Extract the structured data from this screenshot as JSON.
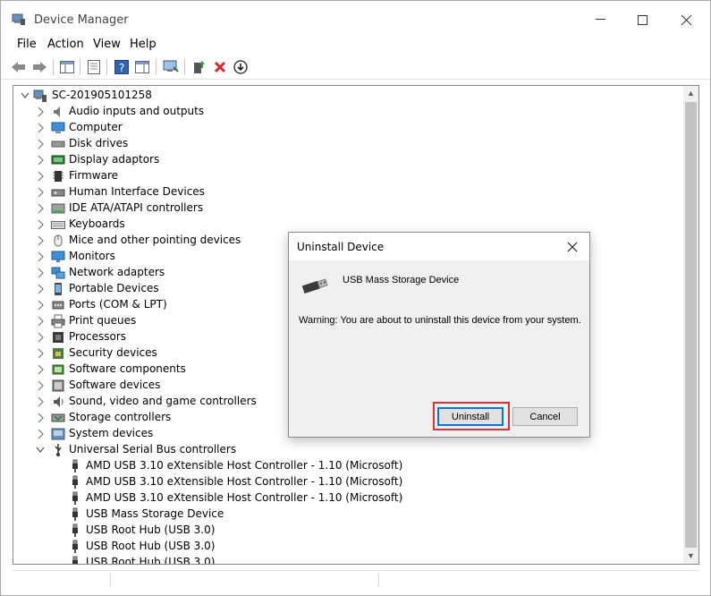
{
  "window": {
    "title": "Device Manager",
    "controls": {
      "minimize": "—",
      "maximize": "☐",
      "close": "✕"
    }
  },
  "menu": [
    "File",
    "Action",
    "View",
    "Help"
  ],
  "tree": {
    "root": "SC-201905101258",
    "categories": [
      "Audio inputs and outputs",
      "Computer",
      "Disk drives",
      "Display adaptors",
      "Firmware",
      "Human Interface Devices",
      "IDE ATA/ATAPI controllers",
      "Keyboards",
      "Mice and other pointing devices",
      "Monitors",
      "Network adapters",
      "Portable Devices",
      "Ports (COM & LPT)",
      "Print queues",
      "Processors",
      "Security devices",
      "Software components",
      "Software devices",
      "Sound, video and game controllers",
      "Storage controllers",
      "System devices",
      "Universal Serial Bus controllers"
    ],
    "usb_children": [
      "AMD USB 3.10 eXtensible Host Controller - 1.10 (Microsoft)",
      "AMD USB 3.10 eXtensible Host Controller - 1.10 (Microsoft)",
      "AMD USB 3.10 eXtensible Host Controller - 1.10 (Microsoft)",
      "USB Mass Storage Device",
      "USB Root Hub (USB 3.0)",
      "USB Root Hub (USB 3.0)",
      "USB Root Hub (USB 3.0)"
    ]
  },
  "dialog": {
    "title": "Uninstall Device",
    "close": "✕",
    "device_name": "USB Mass Storage Device",
    "warning": "Warning: You are about to uninstall this device from your system.",
    "uninstall_label": "Uninstall",
    "cancel_label": "Cancel"
  },
  "colors": {
    "highlight": "#e0303a",
    "default_button_border": "#0078d7",
    "dialog_bg": "#f0f0f0"
  }
}
